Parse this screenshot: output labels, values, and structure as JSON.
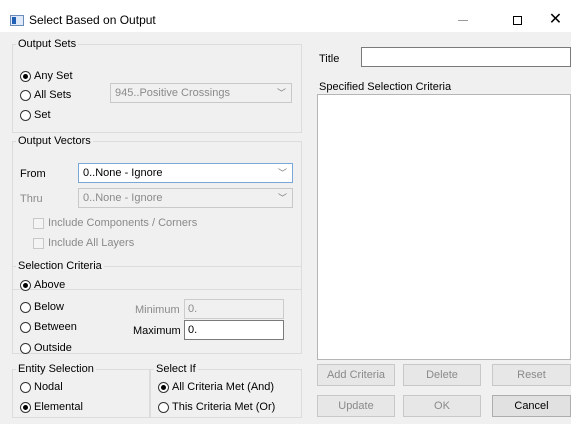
{
  "window": {
    "title": "Select Based on Output",
    "minimize_glyph": "",
    "close_glyph": "✕"
  },
  "output_sets": {
    "legend": "Output Sets",
    "any_set": "Any Set",
    "all_sets": "All Sets",
    "set": "Set",
    "selected": "any_set",
    "set_combo": "945..Positive Crossings"
  },
  "output_vectors": {
    "legend": "Output Vectors",
    "from_label": "From",
    "from_value": "0..None - Ignore",
    "thru_label": "Thru",
    "thru_value": "0..None - Ignore",
    "include_components": "Include Components / Corners",
    "include_layers": "Include All Layers"
  },
  "selection_criteria": {
    "legend": "Selection Criteria",
    "options": [
      "Above",
      "Below",
      "Between",
      "Outside"
    ],
    "selected": "Above",
    "minimum_label": "Minimum",
    "minimum_value": "0.",
    "maximum_label": "Maximum",
    "maximum_value": "0."
  },
  "entity_selection": {
    "legend": "Entity Selection",
    "nodal": "Nodal",
    "elemental": "Elemental",
    "selected": "Elemental"
  },
  "select_if": {
    "legend": "Select If",
    "all_met": "All Criteria Met (And)",
    "this_met": "This Criteria Met (Or)",
    "selected": "all_met"
  },
  "right_panel": {
    "title_label": "Title",
    "title_value": "",
    "specified_label": "Specified Selection Criteria"
  },
  "buttons": {
    "add_criteria": "Add Criteria",
    "delete": "Delete",
    "reset": "Reset",
    "update": "Update",
    "ok": "OK",
    "cancel": "Cancel"
  }
}
